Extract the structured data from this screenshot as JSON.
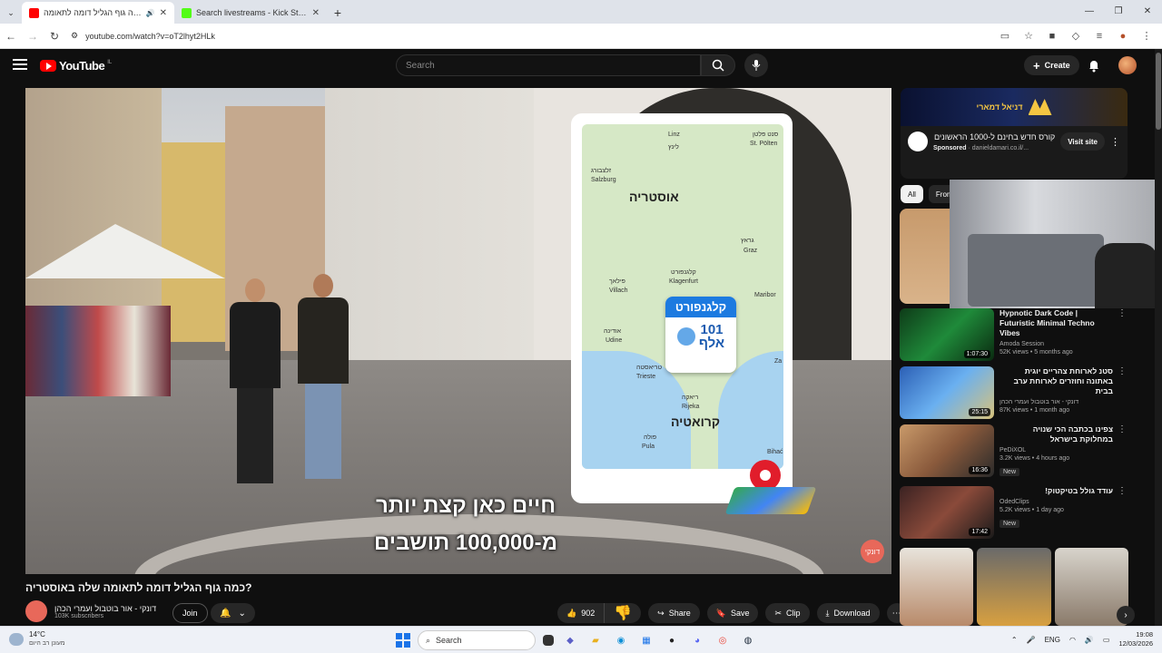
{
  "browser": {
    "tabs": [
      {
        "title": "כמה גוף הגליל דומה לתאומה",
        "favicon_color": "#ff0000",
        "audio": true,
        "active": true
      },
      {
        "title": "Search livestreams - Kick Stream",
        "favicon_color": "#53fc18",
        "active": false
      }
    ],
    "url": "youtube.com/watch?v=oT2lhyt2HLk"
  },
  "youtube": {
    "logo_text": "YouTube",
    "country": "IL",
    "search_placeholder": "Search",
    "create_label": "Create",
    "video": {
      "map_labels": {
        "austria": "אוסטריה",
        "croatia": "קרואטיה",
        "salzburg": "Salzburg",
        "salzburg_he": "זלצבורג",
        "linz": "Linz",
        "linz_he": "לינץ",
        "stpolten": "St. Pölten",
        "stpolten_he": "סנט פלטן",
        "graz": "Graz",
        "graz_he": "גראץ",
        "villach": "Villach",
        "villach_he": "פילאך",
        "klagenfurt": "Klagenfurt",
        "klagenfurt_he": "קלגנפורט",
        "maribor": "Maribor",
        "udine": "Udine",
        "udine_he": "אודינה",
        "trieste": "Trieste",
        "trieste_he": "טריאסטה",
        "rijeka": "Rijeka",
        "rijeka_he": "ריאקה",
        "pula": "Pula",
        "pula_he": "פולה",
        "zagreb": "Za",
        "bihac": "Bihać"
      },
      "city_box": {
        "name": "קלגנפורט",
        "pop_number": "101",
        "pop_unit": "אלף"
      },
      "subtitle_line1": "חיים כאן קצת יותר",
      "subtitle_line2": "מ-100,000 תושבים",
      "watermark": "דונקי"
    },
    "title": "כמה גוף הגליל דומה לתאומה שלה באוסטריה?",
    "channel": {
      "name": "דונקי - אור בוטבול ועמרי הכהן",
      "subscribers": "103K subscribers"
    },
    "join_label": "Join",
    "actions": {
      "likes": "902",
      "share": "Share",
      "save": "Save",
      "clip": "Clip",
      "download": "Download"
    },
    "ad": {
      "banner_name": "דניאל דמארי",
      "title": "קורס חדש בחינם ל-1000 הראשונים",
      "sponsored": "Sponsored",
      "domain": "danieldamari.co.il/...",
      "visit": "Visit site"
    },
    "chips": [
      "All",
      "From"
    ],
    "recommendations": [
      {
        "title": "Hypnotic Dark Code | Futuristic Minimal Techno Vibes",
        "channel": "Amoda Session",
        "meta": "52K views • 5 months ago",
        "duration": "1:07:30",
        "rtl": false,
        "thumb": "#1f8a3a"
      },
      {
        "title": "סטנ לארוחת צהריים יוגית באתונה וחוזרים לארוחת ערב בבית",
        "channel": "דונקי - אור בוטבול ועמרי הכהן",
        "meta": "87K views • 1 month ago",
        "duration": "25:15",
        "rtl": true,
        "thumb": "#2b5fb5"
      },
      {
        "title": "צפינו בכתבה הכי שנויה במחלוקת בישראל",
        "channel": "PeDiXOL",
        "meta": "3.2K views • 4 hours ago",
        "duration": "16:36",
        "badge": "New",
        "rtl": true,
        "thumb": "#8a5a3c"
      },
      {
        "title": "עודד גולל בטיקטוק!",
        "channel": "OdedClips",
        "meta": "5.2K views • 1 day ago",
        "duration": "17:42",
        "badge": "New",
        "rtl": true,
        "thumb": "#3a2222"
      }
    ]
  },
  "taskbar": {
    "weather_temp": "14°C",
    "weather_desc": "מעונן רב היום",
    "search": "Search",
    "lang": "ENG",
    "time": "19:08",
    "date": "12/03/2026"
  }
}
